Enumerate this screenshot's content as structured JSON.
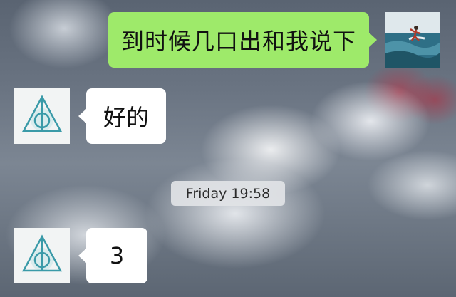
{
  "messages": [
    {
      "side": "right",
      "text": "到时候几口出和我说下",
      "avatar_icon": "surfer-photo-avatar"
    },
    {
      "side": "left",
      "text": "好的",
      "avatar_icon": "deathly-hallows-avatar"
    },
    {
      "side": "left",
      "text": "3",
      "avatar_icon": "deathly-hallows-avatar"
    }
  ],
  "timestamp": "Friday 19:58",
  "colors": {
    "sent_bubble": "#9eea6a",
    "received_bubble": "#ffffff",
    "timestamp_bg": "#e1e3e6",
    "avatar_symbol": "#3a9aa8"
  }
}
